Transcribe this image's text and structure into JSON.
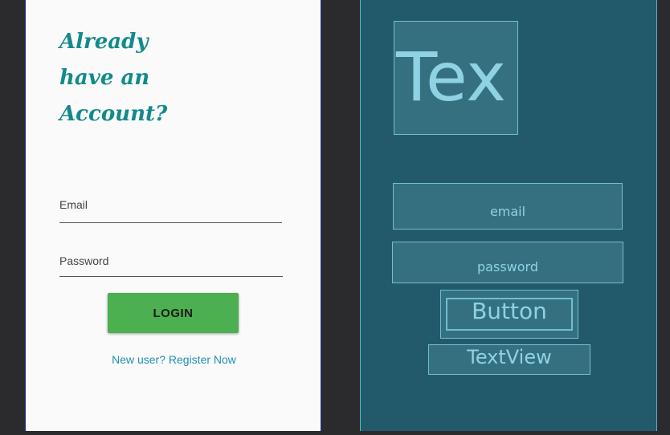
{
  "design": {
    "heading_lines": [
      "Already",
      "have an",
      "Account?"
    ],
    "email_label": "Email",
    "password_label": "Password",
    "login_label": "LOGIN",
    "register_link": "New user? Register Now"
  },
  "blueprint": {
    "title_text": "Tex",
    "email_hint": "email",
    "password_hint": "password",
    "button_text": "Button",
    "textview_text": "TextView"
  },
  "colors": {
    "heading": "#138a8a",
    "login_button": "#4caf50",
    "link": "#1f8fb3",
    "blueprint_bg": "#235a6b",
    "blueprint_outline": "#6fbfd1"
  }
}
